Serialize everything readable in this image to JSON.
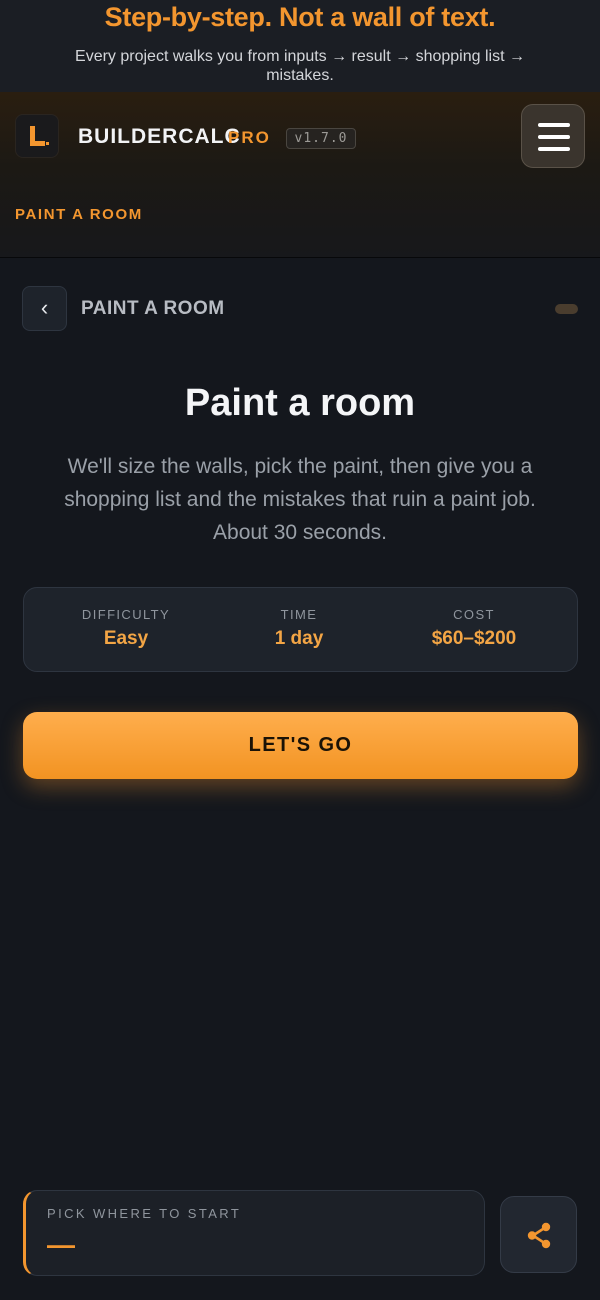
{
  "promo": {
    "title": "Step-by-step. Not a wall of text.",
    "subtitle": "Every project walks you from inputs → result → shopping list → mistakes."
  },
  "header": {
    "logo_icon": "ruler-square-icon",
    "brand": "BUILDERCALC",
    "brand_tier": "PRO",
    "version": "v1.7.0",
    "menu_icon": "hamburger-icon",
    "breadcrumb": "PAINT A ROOM"
  },
  "nav": {
    "back_icon": "chevron-left-icon",
    "back_glyph": "‹",
    "section_label": "PAINT A ROOM"
  },
  "main": {
    "title": "Paint a room",
    "intro": "We'll size the walls, pick the paint, then give you a shopping list and the mistakes that ruin a paint job. About 30 seconds.",
    "stats": [
      {
        "label": "DIFFICULTY",
        "value": "Easy"
      },
      {
        "label": "TIME",
        "value": "1 day"
      },
      {
        "label": "COST",
        "value": "$60–$200"
      }
    ],
    "cta_label": "LET'S GO"
  },
  "footer": {
    "pick_label": "PICK WHERE TO START",
    "pick_value": "—",
    "share_icon": "share-icon"
  },
  "colors": {
    "accent": "#f3962f",
    "background": "#14171d",
    "card": "#1e232b"
  }
}
